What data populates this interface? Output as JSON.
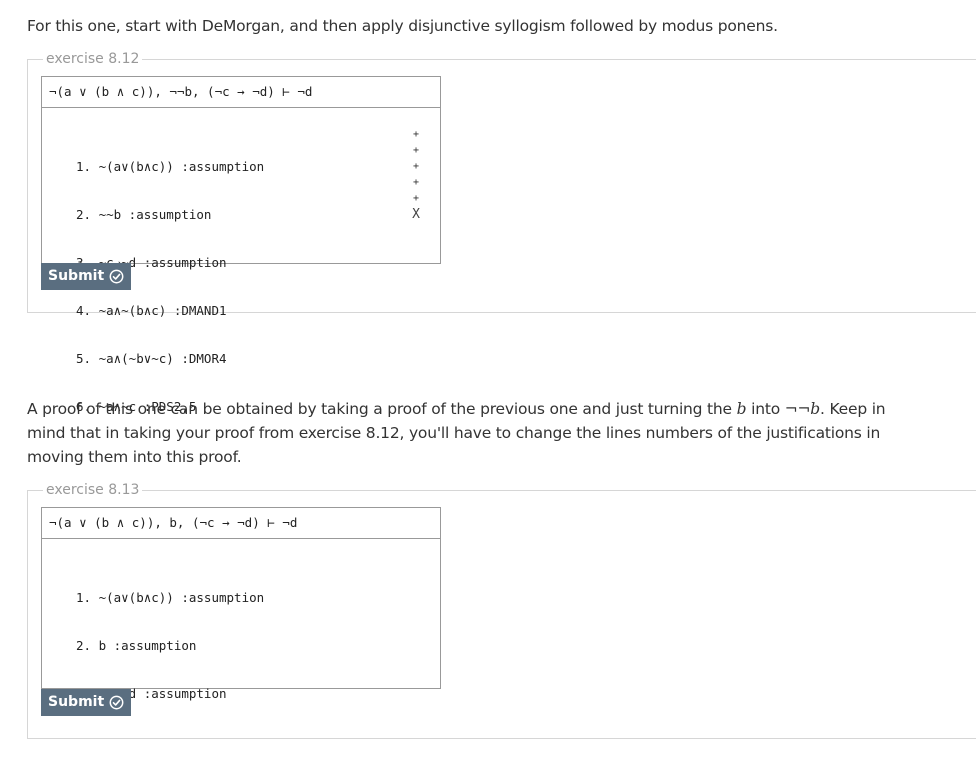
{
  "intro1": "For this one, start with DeMorgan, and then apply disjunctive syllogism followed by modus ponens.",
  "ex1": {
    "legend": "exercise 8.12",
    "goal": "¬(a ∨ (b ∧ c)), ¬¬b, (¬c → ¬d) ⊢ ¬d",
    "lines": [
      "1. ~(a∨(b∧c)) :assumption",
      "2. ~~b :assumption",
      "3. ~c→~d :assumption",
      "4. ~a∧~(b∧c) :DMAND1",
      "5. ~a∧(~b∨~c) :DMOR4",
      "6. ~a∧~c :PDS2,5"
    ],
    "controls": [
      "+",
      "+",
      "+",
      "+",
      "+",
      "X"
    ],
    "submit_label": "Submit"
  },
  "intro2": {
    "part1": "A proof of this one can be obtained by taking a proof of the previous one and just turning the ",
    "b_italic": "b",
    "part2": " into ",
    "nnb_italic": "¬¬b",
    "part3": ". Keep in mind that in taking your proof from exercise 8.12, you'll have to change the lines numbers of the justifications in moving them into this proof."
  },
  "ex2": {
    "legend": "exercise 8.13",
    "goal": "¬(a ∨ (b ∧ c)), b, (¬c → ¬d) ⊢ ¬d",
    "lines": [
      "1. ~(a∨(b∧c)) :assumption",
      "2. b :assumption",
      "3. ~c→~d :assumption"
    ],
    "submit_label": "Submit"
  },
  "colors": {
    "submit_bg": "#5a6e80",
    "border": "#999999",
    "legend": "#999999"
  },
  "icons": {
    "submit": "check-circle-icon"
  }
}
